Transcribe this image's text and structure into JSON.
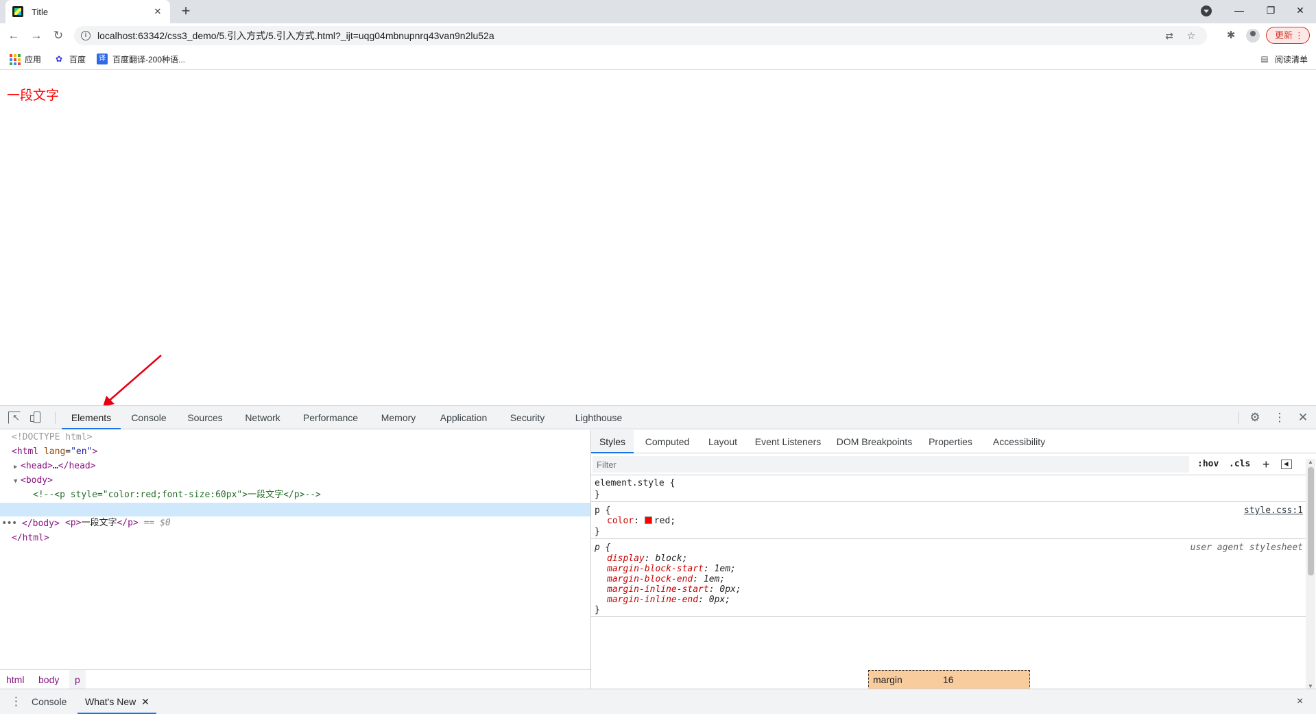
{
  "browser": {
    "tab_title": "Title",
    "url": "localhost:63342/css3_demo/5.引入方式/5.引入方式.html?_ijt=uqg04mbnupnrq43van9n2lu52a",
    "update_label": "更新",
    "bookmarks": [
      {
        "label": "应用",
        "icon": "apps-grid-icon"
      },
      {
        "label": "百度",
        "icon": "baidu-paw-icon"
      },
      {
        "label": "百度翻译-200种语...",
        "icon": "translate-icon"
      }
    ],
    "reading_list": "阅读清单"
  },
  "page": {
    "text": "一段文字",
    "text_color": "#ff0000"
  },
  "devtools": {
    "tabs": [
      "Elements",
      "Console",
      "Sources",
      "Network",
      "Performance",
      "Memory",
      "Application",
      "Security",
      "Lighthouse"
    ],
    "active_tab": "Elements",
    "dom": {
      "doctype": "<!DOCTYPE html>",
      "html_open_tag": "html",
      "html_attr": "lang",
      "html_attr_val": "\"en\"",
      "head_collapsed": "head",
      "head_ellipsis": "…",
      "body_tag": "body",
      "comment": "<!--<p style=\"color:red;font-size:60px\">一段文字</p>-->",
      "p_tag": "p",
      "p_text": "一段文字",
      "dollar": "== $0",
      "body_close": "body",
      "html_close": "html"
    },
    "breadcrumbs": [
      "html",
      "body",
      "p"
    ],
    "styles_tabs": [
      "Styles",
      "Computed",
      "Layout",
      "Event Listeners",
      "DOM Breakpoints",
      "Properties",
      "Accessibility"
    ],
    "filter_placeholder": "Filter",
    "filter_buttons": [
      ":hov",
      ".cls",
      "+"
    ],
    "rules": {
      "element_style_selector": "element.style {",
      "close_brace": "}",
      "p_selector": "p {",
      "p_source": "style.css:1",
      "p_color_name": "color",
      "p_color_value": "red",
      "ua_source": "user agent stylesheet",
      "ua_props": [
        {
          "name": "display",
          "value": "block"
        },
        {
          "name": "margin-block-start",
          "value": "1em"
        },
        {
          "name": "margin-block-end",
          "value": "1em"
        },
        {
          "name": "margin-inline-start",
          "value": "0px"
        },
        {
          "name": "margin-inline-end",
          "value": "0px"
        }
      ]
    },
    "box_model": {
      "margin_label": "margin",
      "margin_value": "16"
    },
    "drawer_tabs": [
      "Console",
      "What's New"
    ],
    "drawer_close": "×"
  }
}
